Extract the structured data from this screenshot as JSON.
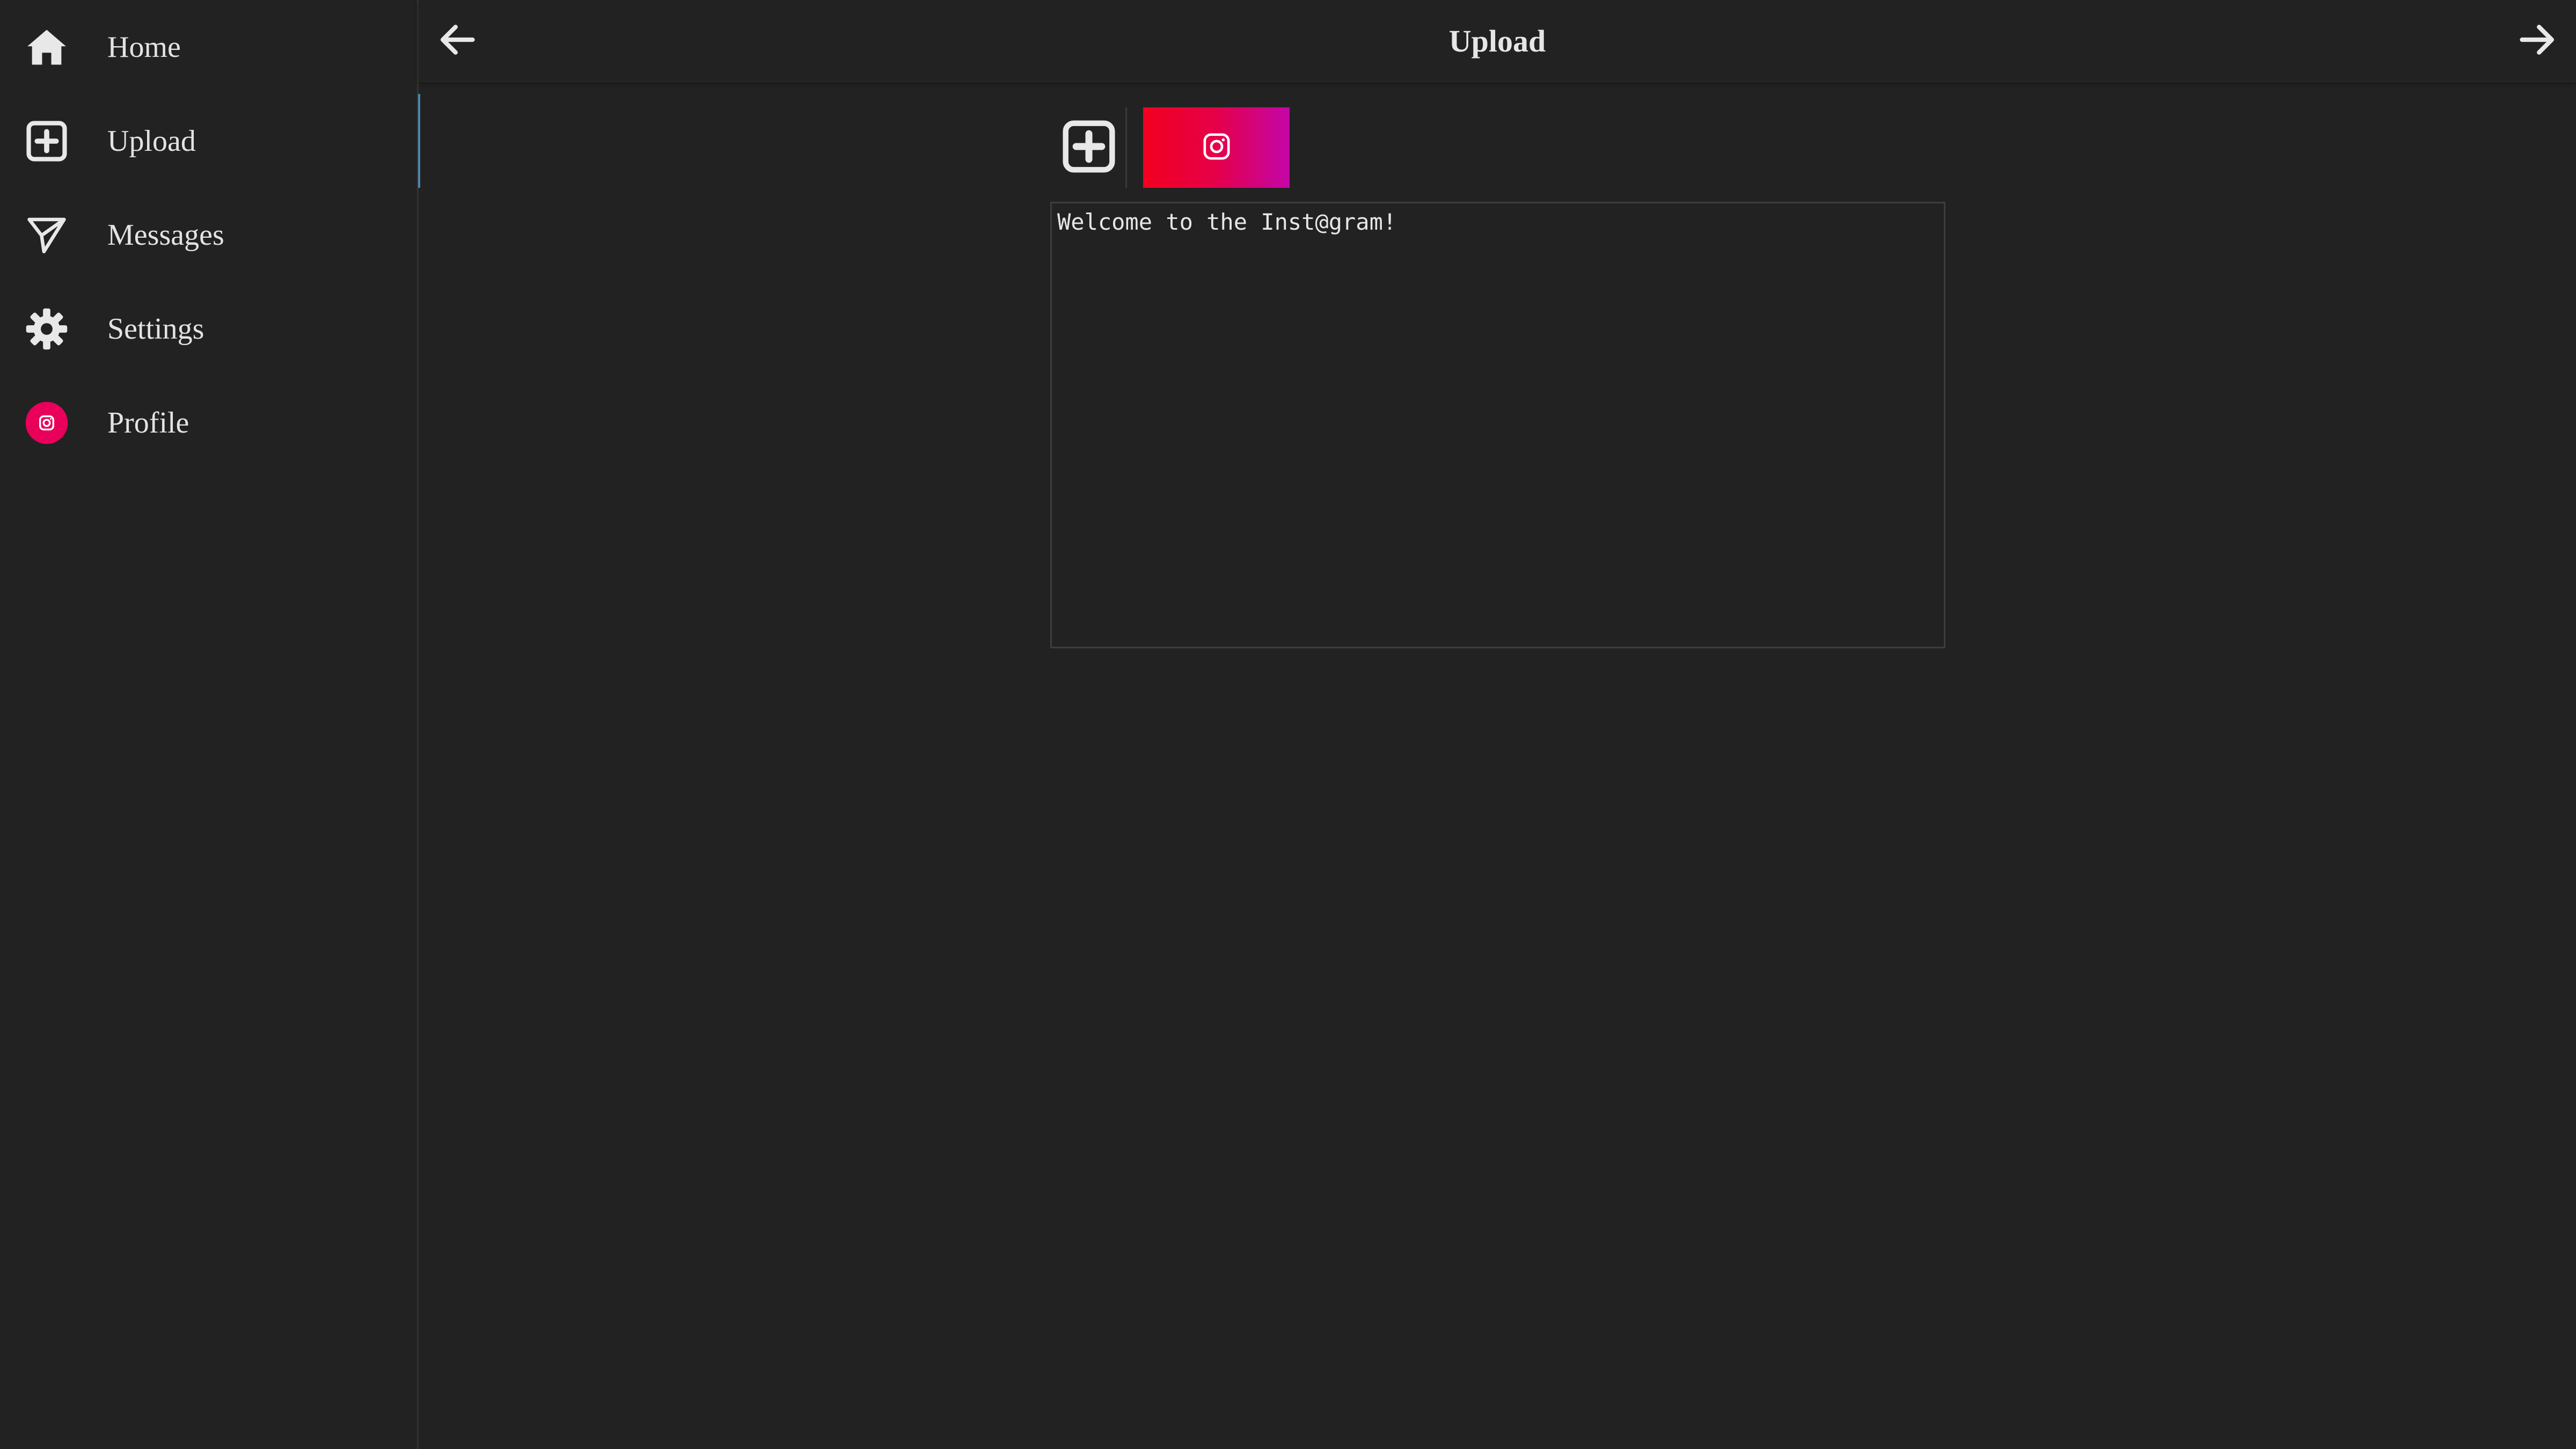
{
  "sidebar": {
    "items": [
      {
        "label": "Home",
        "icon": "home-icon"
      },
      {
        "label": "Upload",
        "icon": "plus-square-icon",
        "active": true
      },
      {
        "label": "Messages",
        "icon": "send-icon"
      },
      {
        "label": "Settings",
        "icon": "gear-icon"
      },
      {
        "label": "Profile",
        "icon": "instagram-avatar-icon"
      }
    ]
  },
  "header": {
    "title": "Upload",
    "back_icon": "arrow-left-icon",
    "forward_icon": "arrow-right-icon"
  },
  "toolbar": {
    "add_icon": "plus-square-icon",
    "instagram_icon": "instagram-icon"
  },
  "editor": {
    "value": "Welcome to the Inst@gram!"
  },
  "colors": {
    "background": "#222222",
    "active_indicator": "#4f86a8",
    "gradient_start": "#f2001f",
    "gradient_end": "#c306a8",
    "avatar": "#e8005a"
  }
}
